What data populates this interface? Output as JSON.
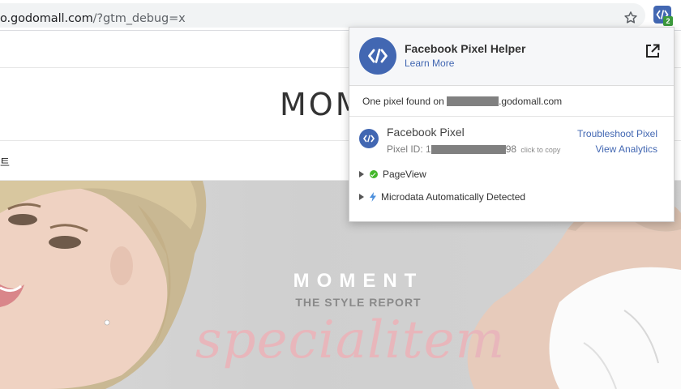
{
  "browser": {
    "url_host": "o.godomall.com",
    "url_path": "/?gtm_debug=x",
    "bookmark_icon": "star-icon",
    "extension": {
      "icon": "code-brackets-icon",
      "badge": "2",
      "color": "#4267b2"
    }
  },
  "site": {
    "logo": "MOM",
    "nav_item": "트",
    "hero": {
      "title": "MOMENT",
      "subtitle": "THE STYLE REPORT",
      "script": "specialitem"
    }
  },
  "popup": {
    "title": "Facebook Pixel Helper",
    "learn_more": "Learn More",
    "external_link_icon": "external-link-icon",
    "found_prefix": "One pixel found on",
    "found_domain": ".godomall.com",
    "pixel": {
      "name": "Facebook Pixel",
      "id_prefix": "Pixel ID: 1",
      "id_suffix": "98",
      "copy_hint": "click to copy",
      "troubleshoot": "Troubleshoot Pixel",
      "analytics": "View Analytics"
    },
    "events": [
      {
        "name": "PageView",
        "status": "success",
        "icon": "check-circle-icon"
      },
      {
        "name": "Microdata Automatically Detected",
        "status": "info",
        "icon": "lightning-icon"
      }
    ],
    "colors": {
      "brand": "#4267b2",
      "success": "#42b72a"
    }
  }
}
